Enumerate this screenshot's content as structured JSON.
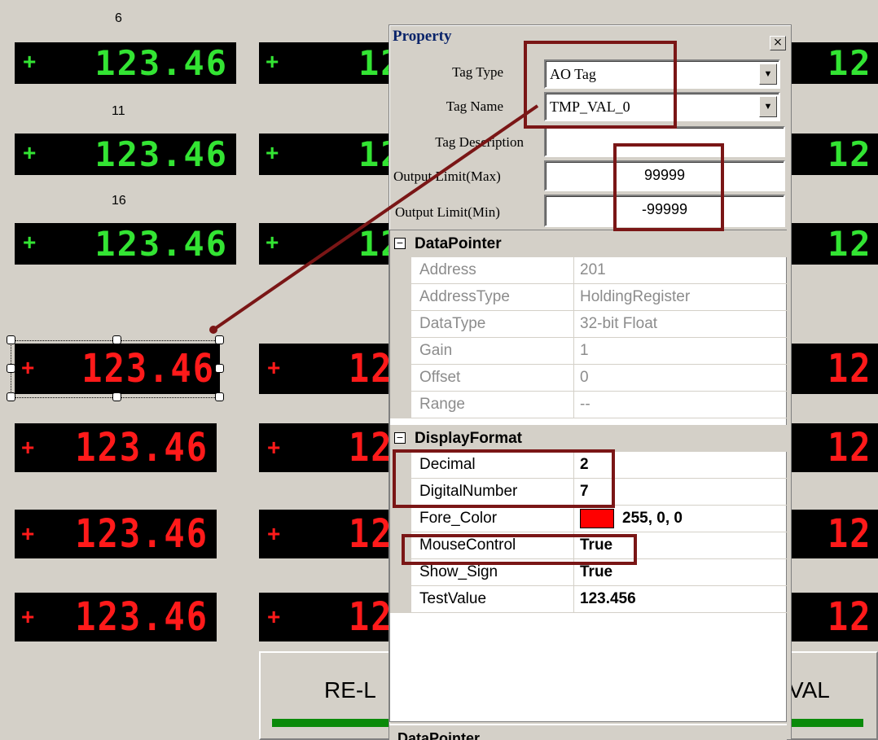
{
  "row_labels": [
    "6",
    "11",
    "16"
  ],
  "display_value": "123.46",
  "display_sign": "+",
  "display_partial": "12",
  "colors": {
    "green": "#33e433",
    "red": "#ff1a1a",
    "highlight": "#7a1616",
    "bar": "#0a8a0a"
  },
  "buttons": {
    "left": "RE-L",
    "right": "VAL"
  },
  "property": {
    "title": "Property",
    "close_icon": "×",
    "fields": {
      "tag_type_label": "Tag Type",
      "tag_type_value": "AO Tag",
      "tag_name_label": "Tag Name",
      "tag_name_value": "TMP_VAL_0",
      "tag_desc_label": "Tag Description",
      "tag_desc_value": "",
      "max_label": "Output Limit(Max)",
      "max_value": "99999",
      "min_label": "Output Limit(Min)",
      "min_value": "-99999"
    },
    "datapointer": {
      "title": "DataPointer",
      "rows": [
        {
          "name": "Address",
          "value": "201"
        },
        {
          "name": "AddressType",
          "value": "HoldingRegister"
        },
        {
          "name": "DataType",
          "value": "32-bit Float"
        },
        {
          "name": "Gain",
          "value": "1"
        },
        {
          "name": "Offset",
          "value": "0"
        },
        {
          "name": "Range",
          "value": "--"
        }
      ]
    },
    "displayformat": {
      "title": "DisplayFormat",
      "rows": [
        {
          "name": "Decimal",
          "value": "2"
        },
        {
          "name": "DigitalNumber",
          "value": "7"
        },
        {
          "name": "Fore_Color",
          "value": "255, 0, 0"
        },
        {
          "name": "MouseControl",
          "value": "True"
        },
        {
          "name": "Show_Sign",
          "value": "True"
        },
        {
          "name": "TestValue",
          "value": "123.456"
        }
      ]
    },
    "bottom_category": "DataPointer"
  }
}
